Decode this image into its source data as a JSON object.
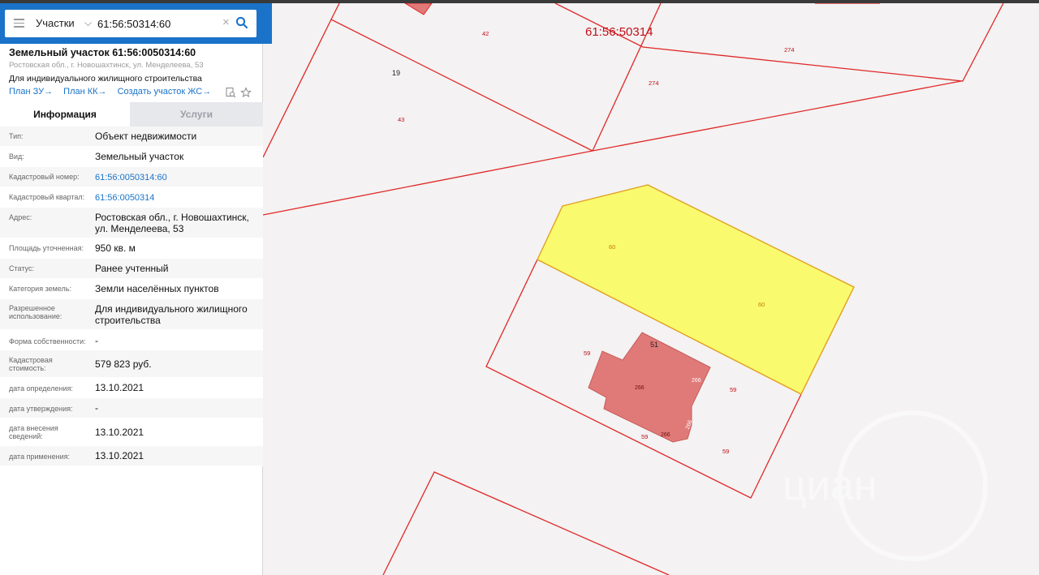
{
  "search": {
    "layer": "Участки",
    "query": "61:56:50314:60"
  },
  "parcel": {
    "title": "Земельный участок 61:56:0050314:60",
    "address_short": "Ростовская обл., г. Новошахтинск, ул. Менделеева, 53",
    "use": "Для индивидуального жилищного строительства",
    "links": [
      "План ЗУ",
      "План КК",
      "Создать участок ЖС"
    ]
  },
  "tabs": [
    "Информация",
    "Услуги"
  ],
  "info": [
    {
      "label": "Тип:",
      "value": "Объект недвижимости"
    },
    {
      "label": "Вид:",
      "value": "Земельный участок"
    },
    {
      "label": "Кадастровый номер:",
      "value": "61:56:0050314:60"
    },
    {
      "label": "Кадастровый квартал:",
      "value": "61:56:0050314"
    },
    {
      "label": "Адрес:",
      "value": "Ростовская обл., г. Новошахтинск, ул. Менделеева, 53"
    },
    {
      "label": "Площадь уточненная:",
      "value": "950 кв. м"
    },
    {
      "label": "Статус:",
      "value": "Ранее учтенный"
    },
    {
      "label": "Категория земель:",
      "value": "Земли населённых пунктов"
    },
    {
      "label": "Разрешенное использование:",
      "value": "Для индивидуального жилищного строительства"
    },
    {
      "label": "Форма собственности:",
      "value": "-"
    },
    {
      "label": "Кадастровая стоимость:",
      "value": "579 823 руб."
    },
    {
      "label": "дата определения:",
      "value": "13.10.2021"
    },
    {
      "label": "дата утверждения:",
      "value": "-"
    },
    {
      "label": "дата внесения сведений:",
      "value": "13.10.2021"
    },
    {
      "label": "дата применения:",
      "value": "13.10.2021"
    }
  ],
  "map": {
    "quarter_label": "61:56:50314",
    "labels": [
      "42",
      "274",
      "274",
      "19",
      "43",
      "60",
      "60",
      "51",
      "59",
      "266",
      "266",
      "266",
      "59",
      "59",
      "59",
      "266"
    ],
    "watermark": "циан",
    "colors": {
      "boundary": "#e02828",
      "selected_fill": "#fafa6e",
      "building_fill": "#e07a78",
      "accent": "#1a73c9"
    }
  }
}
